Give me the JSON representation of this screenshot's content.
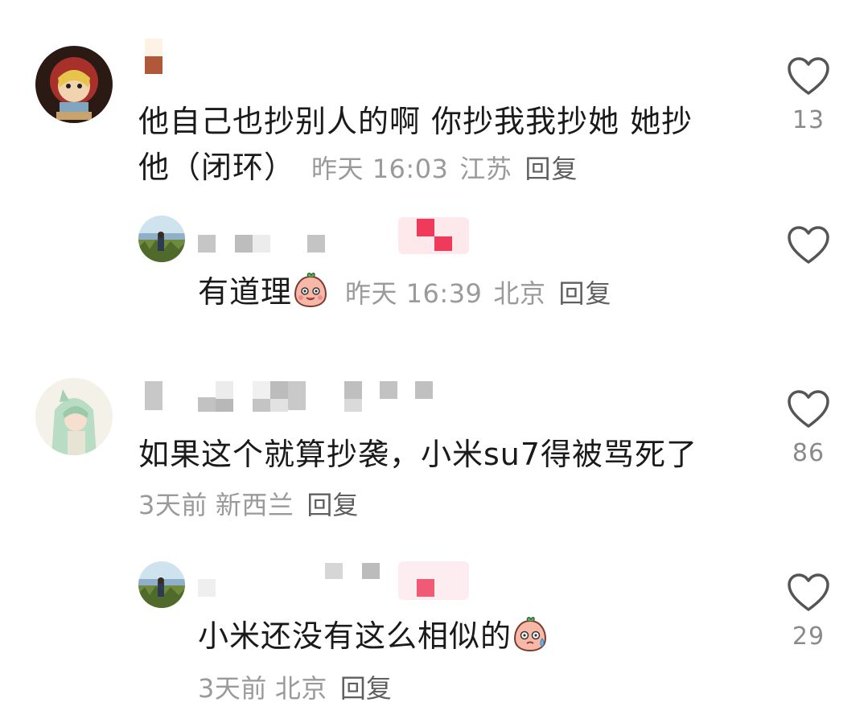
{
  "comments": [
    {
      "text_line1": "他自己也抄别人的啊 你抄我我抄她 她抄",
      "text_line2": "他（闭环）",
      "time": "昨天 16:03",
      "location": "江苏",
      "reply_label": "回复",
      "likes": "13",
      "avatar_icon": "cartoon-girl-avatar",
      "replies": [
        {
          "text": "有道理",
          "emoji_icon": "pink-blob-smile-emoji",
          "time": "昨天 16:39",
          "location": "北京",
          "reply_label": "回复",
          "avatar_icon": "grassland-photo-avatar"
        }
      ]
    },
    {
      "text": "如果这个就算抄袭，小米su7得被骂死了",
      "time": "3天前",
      "location": "新西兰",
      "reply_label": "回复",
      "likes": "86",
      "avatar_icon": "anime-green-hair-avatar",
      "replies": [
        {
          "text": "小米还没有这么相似的",
          "emoji_icon": "pink-blob-sweat-emoji",
          "time": "3天前",
          "location": "北京",
          "reply_label": "回复",
          "likes": "29",
          "avatar_icon": "grassland-photo-avatar"
        }
      ]
    }
  ],
  "colors": {
    "text": "#1a1a1a",
    "meta": "#9a9a9a",
    "reply": "#5f5f5f",
    "heart_outline": "#555555"
  }
}
